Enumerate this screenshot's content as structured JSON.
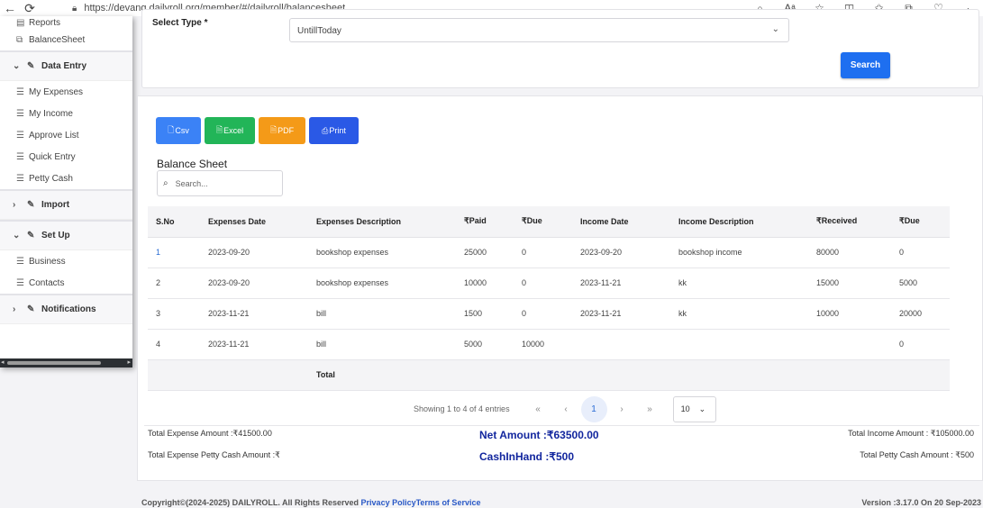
{
  "browser": {
    "url": "https://devang.dailyroll.org/member/#/dailyroll/balancesheet"
  },
  "sidebar": {
    "top_items": [
      {
        "label": "Reports",
        "icon": "report-icon"
      },
      {
        "label": "BalanceSheet",
        "icon": "external-link-icon"
      }
    ],
    "sections": [
      {
        "label": "Data Entry",
        "expanded": true,
        "items": [
          "My Expenses",
          "My Income",
          "Approve List",
          "Quick Entry",
          "Petty Cash"
        ]
      },
      {
        "label": "Import",
        "expanded": false,
        "items": []
      },
      {
        "label": "Set Up",
        "expanded": true,
        "items": [
          "Business",
          "Contacts"
        ]
      },
      {
        "label": "Notifications",
        "expanded": false,
        "items": []
      }
    ]
  },
  "filter": {
    "label": "Select Type *",
    "selected": "UntillToday",
    "search_label": "Search"
  },
  "toolbar": {
    "csv": "Csv",
    "excel": "Excel",
    "pdf": "PDF",
    "print": "Print"
  },
  "table": {
    "title": "Balance Sheet",
    "search_placeholder": "Search...",
    "columns": [
      "S.No",
      "Expenses Date",
      "Expenses Description",
      "₹Paid",
      "₹Due",
      "Income Date",
      "Income Description",
      "₹Received",
      "₹Due"
    ],
    "rows": [
      [
        "1",
        "2023-09-20",
        "bookshop expenses",
        "25000",
        "0",
        "2023-09-20",
        "bookshop income",
        "80000",
        "0"
      ],
      [
        "2",
        "2023-09-20",
        "bookshop expenses",
        "10000",
        "0",
        "2023-11-21",
        "kk",
        "15000",
        "5000"
      ],
      [
        "3",
        "2023-11-21",
        "bill",
        "1500",
        "0",
        "2023-11-21",
        "kk",
        "10000",
        "20000"
      ],
      [
        "4",
        "2023-11-21",
        "bill",
        "5000",
        "10000",
        "",
        "",
        "",
        "0"
      ]
    ],
    "total_label": "Total"
  },
  "pagination": {
    "info": "Showing 1 to 4 of 4 entries",
    "first": "«",
    "prev": "‹",
    "current": "1",
    "next": "›",
    "last": "»",
    "page_size": "10"
  },
  "summary": {
    "total_expense": "Total Expense Amount :₹41500.00",
    "total_expense_petty": "Total Expense Petty Cash Amount :₹",
    "net_amount": "Net Amount :₹63500.00",
    "cash_in_hand": "CashInHand :₹500",
    "total_income": "Total Income Amount : ₹105000.00",
    "total_petty_income": "Total Petty Cash Amount : ₹500"
  },
  "footer": {
    "copyright": "Copyright©(2024-2025) DAILYROLL. All Rights Reserved",
    "privacy": "Privacy Policy",
    "terms": "Terms of Service",
    "version": "Version :3.17.0 On 20 Sep-2023"
  },
  "colors": {
    "primary": "#1e6ff0",
    "excel": "#22b558",
    "pdf": "#f49a18",
    "print": "#2a59e6",
    "net_text": "#12269e"
  }
}
